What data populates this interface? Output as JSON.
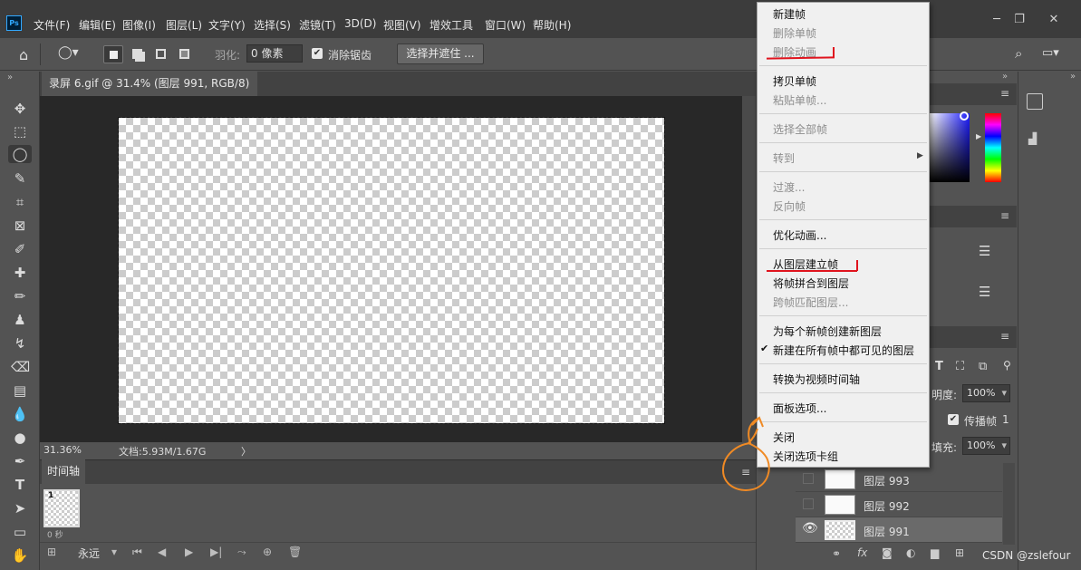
{
  "app": {
    "logo": "Ps"
  },
  "menubar": {
    "items": [
      "文件(F)",
      "编辑(E)",
      "图像(I)",
      "图层(L)",
      "文字(Y)",
      "选择(S)",
      "滤镜(T)",
      "3D(D)",
      "视图(V)",
      "增效工具",
      "窗口(W)",
      "帮助(H)"
    ],
    "window_controls": [
      "minimize-icon",
      "restore-icon",
      "close-icon"
    ]
  },
  "options": {
    "feather_label": "羽化:",
    "feather_value": "0 像素",
    "antialias_label": "消除锯齿",
    "antialias_checked": true,
    "select_mask_label": "选择并遮住 ..."
  },
  "document": {
    "tab_title": "录屏 6.gif @ 31.4% (图层 991, RGB/8) *",
    "tab_close": "×"
  },
  "status": {
    "zoom": "31.36%",
    "doc_info": "文档:5.93M/1.67G",
    "arrow": "〉"
  },
  "timeline": {
    "title": "时间轴",
    "frame_number": "1",
    "frame_delay": "0 秒",
    "loop_value": "永远"
  },
  "layers_panel": {
    "opacity_label": "明度:",
    "opacity_value": "100%",
    "propagate_label": "传播帧",
    "propagate_value": "1",
    "fill_label": "填充:",
    "fill_value": "100%",
    "layers": [
      {
        "name": "图层 993",
        "visible": false
      },
      {
        "name": "图层 992",
        "visible": false
      },
      {
        "name": "图层 991",
        "visible": true
      }
    ]
  },
  "context_menu": {
    "items": [
      {
        "label": "新建帧",
        "disabled": false
      },
      {
        "label": "删除单帧",
        "disabled": true
      },
      {
        "label": "删除动画",
        "disabled": true
      },
      {
        "label": "拷贝单帧",
        "disabled": false
      },
      {
        "label": "粘贴单帧...",
        "disabled": true
      },
      {
        "label": "选择全部帧",
        "disabled": true
      },
      {
        "label": "转到",
        "disabled": true
      },
      {
        "label": "过渡...",
        "disabled": true
      },
      {
        "label": "反向帧",
        "disabled": true
      },
      {
        "label": "优化动画...",
        "disabled": false
      },
      {
        "label": "从图层建立帧",
        "disabled": false
      },
      {
        "label": "将帧拼合到图层",
        "disabled": false
      },
      {
        "label": "跨帧匹配图层...",
        "disabled": true
      },
      {
        "label": "为每个新帧创建新图层",
        "disabled": false
      },
      {
        "label": "新建在所有帧中都可见的图层",
        "disabled": false,
        "checked": true
      },
      {
        "label": "转换为视频时间轴",
        "disabled": false
      },
      {
        "label": "面板选项...",
        "disabled": false
      },
      {
        "label": "关闭",
        "disabled": false
      },
      {
        "label": "关闭选项卡组",
        "disabled": false
      }
    ],
    "check_mark": "✔",
    "submenu_arrow": "▶"
  },
  "colors": {
    "annotation_red": "#e0141e",
    "annotation_orange": "#f08a24"
  },
  "watermark": "CSDN @zslefour"
}
